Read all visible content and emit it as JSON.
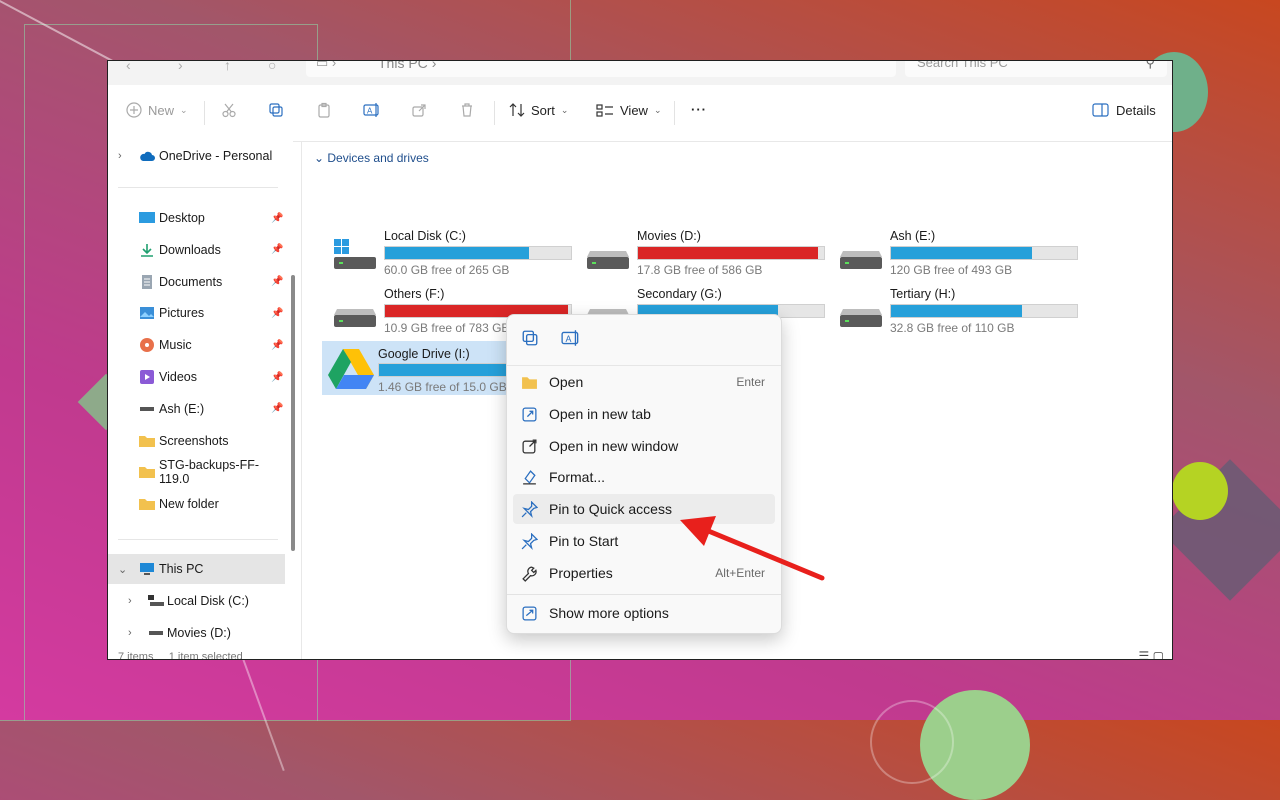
{
  "window": {
    "address": {
      "location": "This PC"
    },
    "search_placeholder": "Search This PC"
  },
  "toolbar": {
    "new_label": "New",
    "sort_label": "Sort",
    "view_label": "View",
    "more_label": "···",
    "details_label": "Details"
  },
  "nav": {
    "onedrive": "OneDrive - Personal",
    "pinned": [
      {
        "label": "Desktop",
        "icon": "desktop-icon"
      },
      {
        "label": "Downloads",
        "icon": "download-icon"
      },
      {
        "label": "Documents",
        "icon": "document-icon"
      },
      {
        "label": "Pictures",
        "icon": "picture-icon"
      },
      {
        "label": "Music",
        "icon": "music-icon"
      },
      {
        "label": "Videos",
        "icon": "video-icon"
      },
      {
        "label": "Ash (E:)",
        "icon": "drive-icon"
      },
      {
        "label": "Screenshots",
        "icon": "folder-icon"
      },
      {
        "label": "STG-backups-FF-119.0",
        "icon": "folder-icon"
      },
      {
        "label": "New folder",
        "icon": "folder-icon"
      }
    ],
    "this_pc": "This PC",
    "sub": [
      {
        "label": "Local Disk (C:)"
      },
      {
        "label": "Movies (D:)"
      }
    ]
  },
  "content": {
    "section_title": "Devices and drives",
    "drives": [
      {
        "name": "Local Disk (C:)",
        "free": "60.0 GB free of 265 GB",
        "used_fraction": 0.774,
        "color": "#26a0da"
      },
      {
        "name": "Movies (D:)",
        "free": "17.8 GB free of 586 GB",
        "used_fraction": 0.97,
        "color": "#da2626"
      },
      {
        "name": "Ash (E:)",
        "free": "120 GB free of 493 GB",
        "used_fraction": 0.757,
        "color": "#26a0da"
      },
      {
        "name": "Others (F:)",
        "free": "10.9 GB free of 783 GB",
        "used_fraction": 0.986,
        "color": "#da2626"
      },
      {
        "name": "Secondary (G:)",
        "free": "24.0 GB free of 98.0 GB",
        "used_fraction": 0.755,
        "color": "#26a0da"
      },
      {
        "name": "Tertiary (H:)",
        "free": "32.8 GB free of 110 GB",
        "used_fraction": 0.702,
        "color": "#26a0da"
      },
      {
        "name": "Google Drive (I:)",
        "free": "1.46 GB free of 15.0 GB",
        "used_fraction": 0.903,
        "color": "#26a0da"
      }
    ]
  },
  "context_menu": {
    "items": [
      {
        "label": "Open",
        "shortcut": "Enter"
      },
      {
        "label": "Open in new tab",
        "shortcut": ""
      },
      {
        "label": "Open in new window",
        "shortcut": ""
      },
      {
        "label": "Format...",
        "shortcut": ""
      },
      {
        "label": "Pin to Quick access",
        "shortcut": ""
      },
      {
        "label": "Pin to Start",
        "shortcut": ""
      },
      {
        "label": "Properties",
        "shortcut": "Alt+Enter"
      }
    ],
    "more": "Show more options"
  },
  "status": {
    "items": "7 items",
    "selected": "1 item selected"
  }
}
